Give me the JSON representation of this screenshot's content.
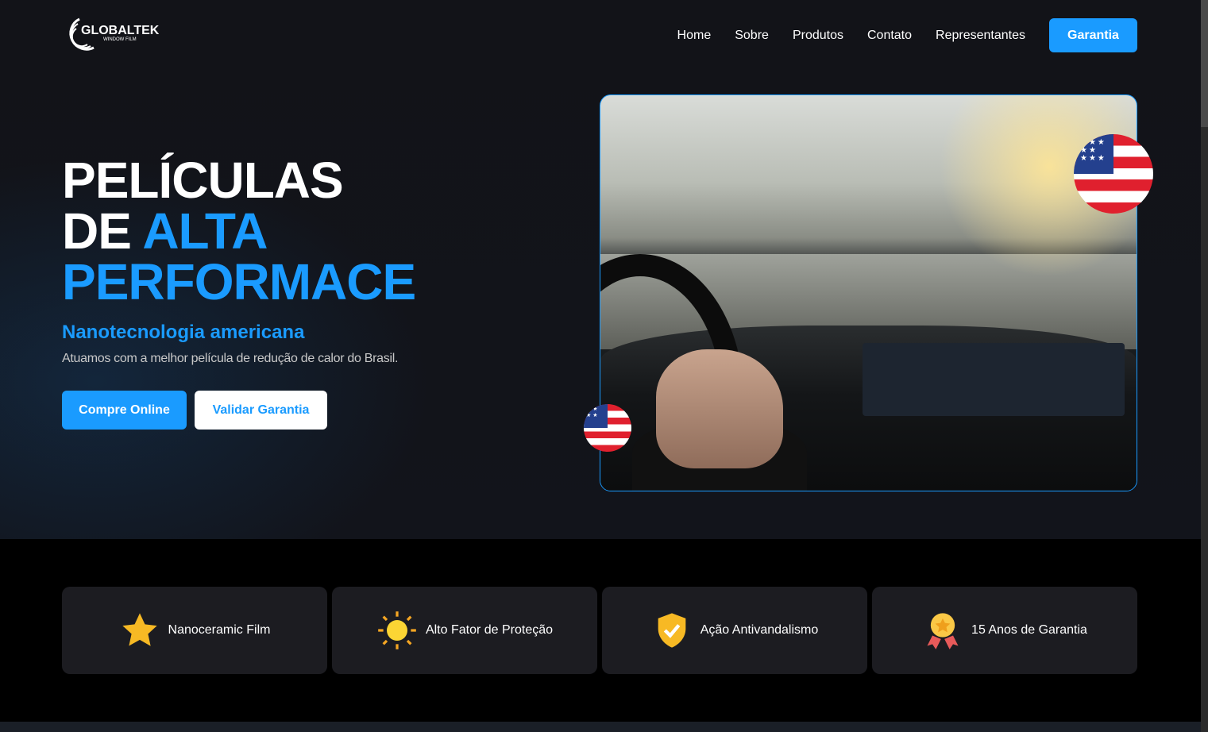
{
  "logo": {
    "name": "GLOBALTEK",
    "tagline": "WINDOW FILM"
  },
  "nav": {
    "items": [
      "Home",
      "Sobre",
      "Produtos",
      "Contato",
      "Representantes"
    ],
    "cta": "Garantia"
  },
  "hero": {
    "title_line1": "PELÍCULAS",
    "title_line2a": "DE ",
    "title_line2b": "ALTA",
    "title_line3": "PERFORMACE",
    "subtitle": "Nanotecnologia americana",
    "description": "Atuamos com a melhor película de redução de calor do Brasil.",
    "btn_primary": "Compre Online",
    "btn_secondary": "Validar Garantia"
  },
  "features": [
    {
      "icon": "star-icon",
      "label": "Nanoceramic Film"
    },
    {
      "icon": "sun-icon",
      "label": "Alto Fator de Proteção"
    },
    {
      "icon": "shield-check-icon",
      "label": "Ação Antivandalismo"
    },
    {
      "icon": "medal-icon",
      "label": "15 Anos de Garantia"
    }
  ],
  "colors": {
    "accent": "#1a9bff",
    "card": "#1c1c21"
  }
}
